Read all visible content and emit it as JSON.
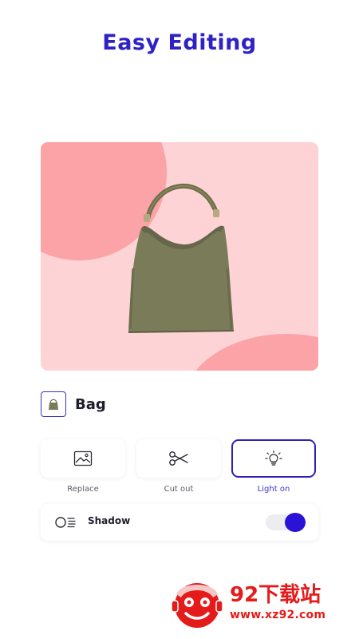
{
  "header": {
    "title": "Easy Editing"
  },
  "product": {
    "name": "Bag",
    "thumbnail_icon": "bag-thumbnail-icon"
  },
  "tools": [
    {
      "label": "Replace",
      "icon": "image-icon",
      "selected": false
    },
    {
      "label": "Cut out",
      "icon": "scissors-icon",
      "selected": false
    },
    {
      "label": "Light on",
      "icon": "lightbulb-icon",
      "selected": true
    }
  ],
  "shadow": {
    "label": "Shadow",
    "icon": "shadow-icon",
    "enabled": true
  },
  "watermark": {
    "title": "92下载站",
    "url": "www.xz92.com"
  },
  "colors": {
    "accent": "#2f22c5",
    "card_background": "#fdd3d5",
    "card_shapes": "#fba3a7",
    "toggle_on": "#2a12d6",
    "watermark": "#e51b1b"
  }
}
